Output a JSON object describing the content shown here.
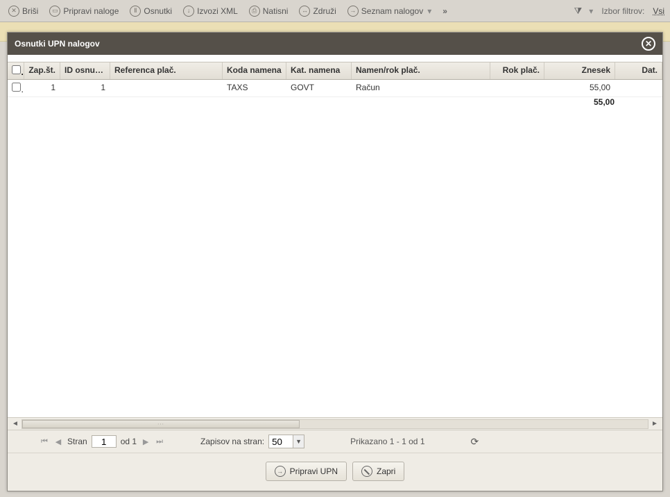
{
  "toolbar": {
    "brisi": "Briši",
    "pripravi_naloge": "Pripravi naloge",
    "osnutki": "Osnutki",
    "izvozi_xml": "Izvozi XML",
    "natisni": "Natisni",
    "zdruzi": "Združi",
    "seznam_nalogov": "Seznam nalogov",
    "overflow": "»",
    "filter_label": "Izbor filtrov:",
    "filter_all": "Vsi"
  },
  "modal": {
    "title": "Osnutki UPN nalogov"
  },
  "grid": {
    "headers": {
      "zap": "Zap.št.",
      "id": "ID osnutka",
      "ref": "Referenca plač.",
      "koda": "Koda namena",
      "kat": "Kat. namena",
      "namen": "Namen/rok plač.",
      "rok": "Rok plač.",
      "znesek": "Znesek",
      "dat": "Dat."
    },
    "rows": [
      {
        "zap": "1",
        "id": "1",
        "ref": "",
        "koda": "TAXS",
        "kat": "GOVT",
        "namen": "Račun",
        "rok": "",
        "znesek": "55,00",
        "dat": ""
      }
    ],
    "total_znesek": "55,00"
  },
  "paging": {
    "stran_label": "Stran",
    "page_value": "1",
    "od_label": "od 1",
    "zapisov_label": "Zapisov na stran:",
    "page_size": "50",
    "status": "Prikazano 1 - 1 od 1"
  },
  "actions": {
    "pripravi_upn": "Pripravi UPN",
    "zapri": "Zapri"
  }
}
